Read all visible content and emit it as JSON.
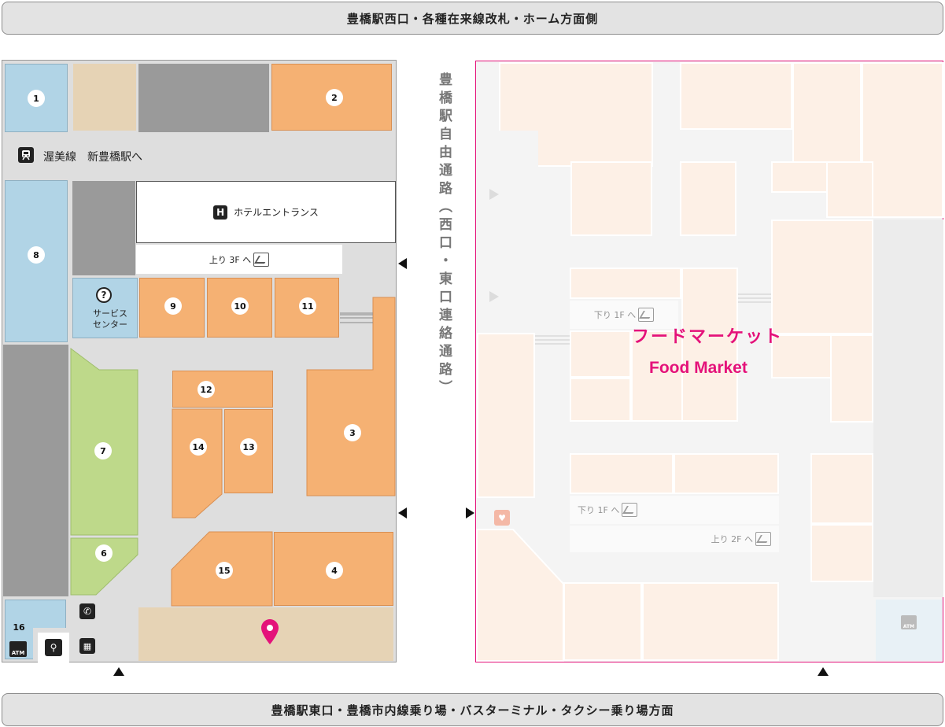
{
  "banners": {
    "top": "豊橋駅西口・各種在来線改札・ホーム方面側",
    "bottom": "豊橋駅東口・豊橋市内線乗り場・バスターミナル・タクシー乗り場方面"
  },
  "corridor_label": "豊橋駅自由通路（西口・東口連絡通路）",
  "rail": {
    "label": "渥美線　新豊橋駅へ",
    "icon": "train-icon"
  },
  "hotel": {
    "label": "ホテルエントランス",
    "icon_letter": "H"
  },
  "escalator_up_3f": "上り 3F へ",
  "service_center": {
    "line1": "サービス",
    "line2": "センター",
    "icon": "help-icon"
  },
  "shops": [
    "1",
    "2",
    "3",
    "4",
    "6",
    "7",
    "8",
    "9",
    "10",
    "11",
    "12",
    "13",
    "14",
    "15",
    "16"
  ],
  "amenities": {
    "atm": "ATM",
    "phone_icon": "phone-icon",
    "restroom_icon": "restroom-icon",
    "locker_icon": "locker-icon",
    "location_pin_icon": "location-pin-icon"
  },
  "food_market": {
    "name_jp": "フードマーケット",
    "name_en": "Food Market",
    "escalator_down_1f_a": "下り 1F へ",
    "escalator_down_1f_b": "下り 1F へ",
    "escalator_up_2f": "上り 2F へ",
    "atm": "ATM"
  },
  "colors": {
    "shop_orange": "#f5b173",
    "shop_blue": "#b1d4e6",
    "shop_green": "#bed98a",
    "beige": "#e6d3b5",
    "dark_gray": "#9a9a9a",
    "corridor": "#dedede",
    "food_market_accent": "#e4127a",
    "food_market_shop": "#fdf0e6"
  }
}
